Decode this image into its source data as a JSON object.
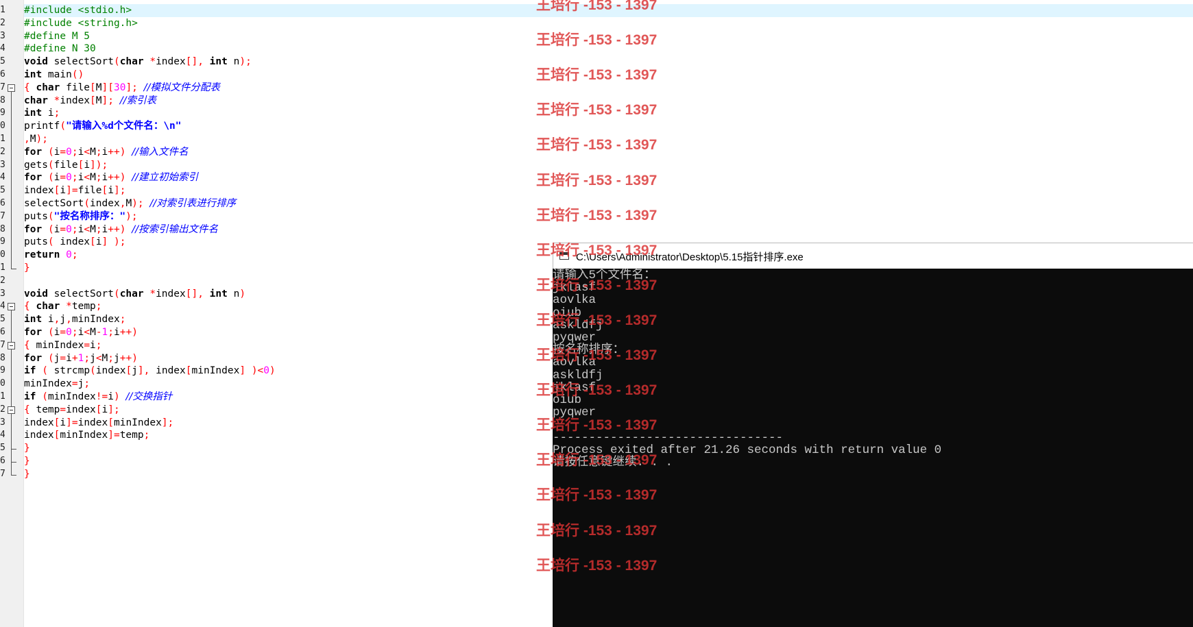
{
  "editor": {
    "line_numbers": [
      "1",
      "2",
      "3",
      "4",
      "5",
      "6",
      "7",
      "8",
      "9",
      "0",
      "1",
      "2",
      "3",
      "4",
      "5",
      "6",
      "7",
      "8",
      "9",
      "0",
      "1",
      "2",
      "3",
      "4",
      "5",
      "6",
      "7",
      "8",
      "9",
      "0",
      "1",
      "2",
      "3",
      "4",
      "5",
      "6",
      "7"
    ],
    "code_lines": [
      [
        [
          "#include <stdio.h>",
          "pp"
        ]
      ],
      [
        [
          "#include <string.h>",
          "pp"
        ]
      ],
      [
        [
          "#define M 5",
          "pp"
        ]
      ],
      [
        [
          "#define N 30",
          "pp"
        ]
      ],
      [
        [
          "void",
          "kw"
        ],
        [
          " selectSort",
          ""
        ],
        [
          "(",
          "sym"
        ],
        [
          "char",
          "kw"
        ],
        [
          " ",
          ""
        ],
        [
          "*",
          "sym"
        ],
        [
          "index",
          ""
        ],
        [
          "[],",
          "sym"
        ],
        [
          " ",
          ""
        ],
        [
          "int",
          "kw"
        ],
        [
          " n",
          ""
        ],
        [
          ");",
          "sym"
        ]
      ],
      [
        [
          "int",
          "kw"
        ],
        [
          " main",
          ""
        ],
        [
          "()",
          "sym"
        ]
      ],
      [
        [
          "{",
          "sym"
        ],
        [
          " ",
          ""
        ],
        [
          "char",
          "kw"
        ],
        [
          " file",
          ""
        ],
        [
          "[",
          "sym"
        ],
        [
          "M",
          ""
        ],
        [
          "][",
          "sym"
        ],
        [
          "30",
          "num"
        ],
        [
          "];",
          "sym"
        ],
        [
          " ",
          ""
        ],
        [
          "//模拟文件分配表",
          "cm"
        ]
      ],
      [
        [
          "char",
          "kw"
        ],
        [
          " ",
          ""
        ],
        [
          "*",
          "sym"
        ],
        [
          "index",
          ""
        ],
        [
          "[",
          "sym"
        ],
        [
          "M",
          ""
        ],
        [
          "];",
          "sym"
        ],
        [
          " ",
          ""
        ],
        [
          "//索引表",
          "cm"
        ]
      ],
      [
        [
          "int",
          "kw"
        ],
        [
          " i",
          ""
        ],
        [
          ";",
          "sym"
        ]
      ],
      [
        [
          "printf",
          ""
        ],
        [
          "(",
          "sym"
        ],
        [
          "\"请输入%d个文件名：\\n\"",
          "str"
        ]
      ],
      [
        [
          ",",
          "sym"
        ],
        [
          "M",
          ""
        ],
        [
          ");",
          "sym"
        ]
      ],
      [
        [
          "for",
          "kw"
        ],
        [
          " ",
          ""
        ],
        [
          "(",
          "sym"
        ],
        [
          "i",
          ""
        ],
        [
          "=",
          "sym"
        ],
        [
          "0",
          "num"
        ],
        [
          ";",
          "sym"
        ],
        [
          "i",
          ""
        ],
        [
          "<",
          "sym"
        ],
        [
          "M",
          ""
        ],
        [
          ";",
          "sym"
        ],
        [
          "i",
          ""
        ],
        [
          "++)",
          "sym"
        ],
        [
          " ",
          ""
        ],
        [
          "//输入文件名",
          "cm"
        ]
      ],
      [
        [
          "gets",
          ""
        ],
        [
          "(",
          "sym"
        ],
        [
          "file",
          ""
        ],
        [
          "[",
          "sym"
        ],
        [
          "i",
          ""
        ],
        [
          "]);",
          "sym"
        ]
      ],
      [
        [
          "for",
          "kw"
        ],
        [
          " ",
          ""
        ],
        [
          "(",
          "sym"
        ],
        [
          "i",
          ""
        ],
        [
          "=",
          "sym"
        ],
        [
          "0",
          "num"
        ],
        [
          ";",
          "sym"
        ],
        [
          "i",
          ""
        ],
        [
          "<",
          "sym"
        ],
        [
          "M",
          ""
        ],
        [
          ";",
          "sym"
        ],
        [
          "i",
          ""
        ],
        [
          "++)",
          "sym"
        ],
        [
          " ",
          ""
        ],
        [
          "//建立初始索引",
          "cm"
        ]
      ],
      [
        [
          "index",
          ""
        ],
        [
          "[",
          "sym"
        ],
        [
          "i",
          ""
        ],
        [
          "]=",
          "sym"
        ],
        [
          "file",
          ""
        ],
        [
          "[",
          "sym"
        ],
        [
          "i",
          ""
        ],
        [
          "];",
          "sym"
        ]
      ],
      [
        [
          "selectSort",
          ""
        ],
        [
          "(",
          "sym"
        ],
        [
          "index",
          ""
        ],
        [
          ",",
          "sym"
        ],
        [
          "M",
          ""
        ],
        [
          ");",
          "sym"
        ],
        [
          " ",
          ""
        ],
        [
          "//对索引表进行排序",
          "cm"
        ]
      ],
      [
        [
          "puts",
          ""
        ],
        [
          "(",
          "sym"
        ],
        [
          "\"按名称排序：\"",
          "str"
        ],
        [
          ");",
          "sym"
        ]
      ],
      [
        [
          "for",
          "kw"
        ],
        [
          " ",
          ""
        ],
        [
          "(",
          "sym"
        ],
        [
          "i",
          ""
        ],
        [
          "=",
          "sym"
        ],
        [
          "0",
          "num"
        ],
        [
          ";",
          "sym"
        ],
        [
          "i",
          ""
        ],
        [
          "<",
          "sym"
        ],
        [
          "M",
          ""
        ],
        [
          ";",
          "sym"
        ],
        [
          "i",
          ""
        ],
        [
          "++)",
          "sym"
        ],
        [
          " ",
          ""
        ],
        [
          "//按索引输出文件名",
          "cm"
        ]
      ],
      [
        [
          "puts",
          ""
        ],
        [
          "(",
          "sym"
        ],
        [
          " index",
          ""
        ],
        [
          "[",
          "sym"
        ],
        [
          "i",
          ""
        ],
        [
          "]",
          "sym"
        ],
        [
          " ",
          ""
        ],
        [
          ");",
          "sym"
        ]
      ],
      [
        [
          "return",
          "kw"
        ],
        [
          " ",
          ""
        ],
        [
          "0",
          "num"
        ],
        [
          ";",
          "sym"
        ]
      ],
      [
        [
          "}",
          "sym"
        ]
      ],
      [],
      [
        [
          "void",
          "kw"
        ],
        [
          " selectSort",
          ""
        ],
        [
          "(",
          "sym"
        ],
        [
          "char",
          "kw"
        ],
        [
          " ",
          ""
        ],
        [
          "*",
          "sym"
        ],
        [
          "index",
          ""
        ],
        [
          "[],",
          "sym"
        ],
        [
          " ",
          ""
        ],
        [
          "int",
          "kw"
        ],
        [
          " n",
          ""
        ],
        [
          ")",
          "sym"
        ]
      ],
      [
        [
          "{",
          "sym"
        ],
        [
          " ",
          ""
        ],
        [
          "char",
          "kw"
        ],
        [
          " ",
          ""
        ],
        [
          "*",
          "sym"
        ],
        [
          "temp",
          ""
        ],
        [
          ";",
          "sym"
        ]
      ],
      [
        [
          "int",
          "kw"
        ],
        [
          " i",
          ""
        ],
        [
          ",",
          "sym"
        ],
        [
          "j",
          ""
        ],
        [
          ",",
          "sym"
        ],
        [
          "minIndex",
          ""
        ],
        [
          ";",
          "sym"
        ]
      ],
      [
        [
          "for",
          "kw"
        ],
        [
          " ",
          ""
        ],
        [
          "(",
          "sym"
        ],
        [
          "i",
          ""
        ],
        [
          "=",
          "sym"
        ],
        [
          "0",
          "num"
        ],
        [
          ";",
          "sym"
        ],
        [
          "i",
          ""
        ],
        [
          "<",
          "sym"
        ],
        [
          "M",
          ""
        ],
        [
          "-",
          "sym"
        ],
        [
          "1",
          "num"
        ],
        [
          ";",
          "sym"
        ],
        [
          "i",
          ""
        ],
        [
          "++)",
          "sym"
        ]
      ],
      [
        [
          "{",
          "sym"
        ],
        [
          " minIndex",
          ""
        ],
        [
          "=",
          "sym"
        ],
        [
          "i",
          ""
        ],
        [
          ";",
          "sym"
        ]
      ],
      [
        [
          "for",
          "kw"
        ],
        [
          " ",
          ""
        ],
        [
          "(",
          "sym"
        ],
        [
          "j",
          ""
        ],
        [
          "=",
          "sym"
        ],
        [
          "i",
          ""
        ],
        [
          "+",
          "sym"
        ],
        [
          "1",
          "num"
        ],
        [
          ";",
          "sym"
        ],
        [
          "j",
          ""
        ],
        [
          "<",
          "sym"
        ],
        [
          "M",
          ""
        ],
        [
          ";",
          "sym"
        ],
        [
          "j",
          ""
        ],
        [
          "++)",
          "sym"
        ]
      ],
      [
        [
          "if",
          "kw"
        ],
        [
          " ",
          ""
        ],
        [
          "(",
          "sym"
        ],
        [
          " strcmp",
          ""
        ],
        [
          "(",
          "sym"
        ],
        [
          "index",
          ""
        ],
        [
          "[",
          "sym"
        ],
        [
          "j",
          ""
        ],
        [
          "],",
          "sym"
        ],
        [
          " index",
          ""
        ],
        [
          "[",
          "sym"
        ],
        [
          "minIndex",
          ""
        ],
        [
          "]",
          "sym"
        ],
        [
          " ",
          ""
        ],
        [
          ")<",
          "sym"
        ],
        [
          "0",
          "num"
        ],
        [
          ")",
          "sym"
        ]
      ],
      [
        [
          "minIndex",
          ""
        ],
        [
          "=",
          "sym"
        ],
        [
          "j",
          ""
        ],
        [
          ";",
          "sym"
        ]
      ],
      [
        [
          "if",
          "kw"
        ],
        [
          " ",
          ""
        ],
        [
          "(",
          "sym"
        ],
        [
          "minIndex",
          ""
        ],
        [
          "!=",
          "sym"
        ],
        [
          "i",
          ""
        ],
        [
          ")",
          "sym"
        ],
        [
          " ",
          ""
        ],
        [
          "//交换指针",
          "cm"
        ]
      ],
      [
        [
          "{",
          "sym"
        ],
        [
          " temp",
          ""
        ],
        [
          "=",
          "sym"
        ],
        [
          "index",
          ""
        ],
        [
          "[",
          "sym"
        ],
        [
          "i",
          ""
        ],
        [
          "];",
          "sym"
        ]
      ],
      [
        [
          "index",
          ""
        ],
        [
          "[",
          "sym"
        ],
        [
          "i",
          ""
        ],
        [
          "]=",
          "sym"
        ],
        [
          "index",
          ""
        ],
        [
          "[",
          "sym"
        ],
        [
          "minIndex",
          ""
        ],
        [
          "];",
          "sym"
        ]
      ],
      [
        [
          "index",
          ""
        ],
        [
          "[",
          "sym"
        ],
        [
          "minIndex",
          ""
        ],
        [
          "]=",
          "sym"
        ],
        [
          "temp",
          ""
        ],
        [
          ";",
          "sym"
        ]
      ],
      [
        [
          "}",
          "sym"
        ]
      ],
      [
        [
          "}",
          "sym"
        ]
      ],
      [
        [
          "}",
          "sym"
        ]
      ]
    ]
  },
  "console": {
    "title": "C:\\Users\\Administrator\\Desktop\\5.15指针排序.exe",
    "lines": [
      "请输入5个文件名：",
      "jklasf",
      "aovlka",
      "oiub",
      "askldfj",
      "pyqwer",
      "按名称排序：",
      "aovlka",
      "askldfj",
      "jklasf",
      "oiub",
      "pyqwer",
      "",
      "--------------------------------",
      "Process exited after 21.26 seconds with return value 0",
      "请按任意键继续. . ."
    ]
  },
  "watermark": {
    "text": "王培行 -153 - 1397",
    "count": 17,
    "color": "#da3232"
  }
}
